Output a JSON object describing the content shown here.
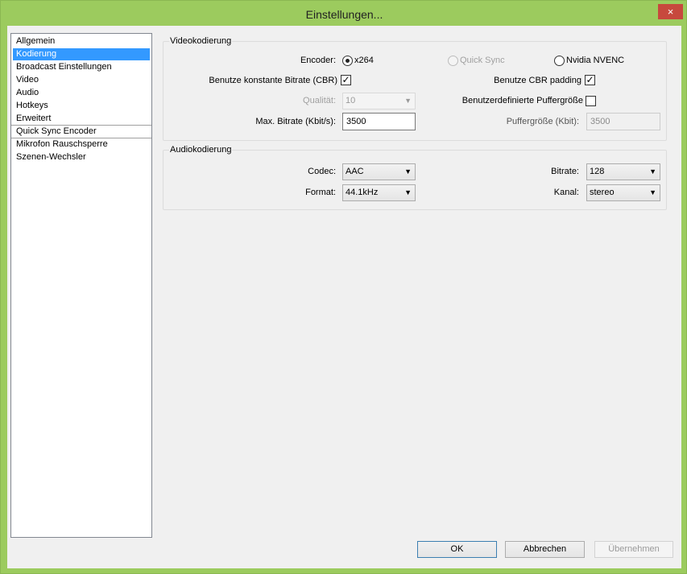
{
  "window": {
    "title": "Einstellungen...",
    "close_glyph": "×"
  },
  "nav": {
    "items": [
      {
        "label": "Allgemein"
      },
      {
        "label": "Kodierung"
      },
      {
        "label": "Broadcast Einstellungen"
      },
      {
        "label": "Video"
      },
      {
        "label": "Audio"
      },
      {
        "label": "Hotkeys"
      },
      {
        "label": "Erweitert"
      },
      {
        "label": "Quick Sync Encoder"
      },
      {
        "label": "Mikrofon Rauschsperre"
      },
      {
        "label": "Szenen-Wechsler"
      }
    ],
    "selected": "Kodierung"
  },
  "video": {
    "group_label": "Videokodierung",
    "encoder_label": "Encoder:",
    "encoder_options": [
      {
        "label": "x264",
        "checked": true,
        "enabled": true
      },
      {
        "label": "Quick Sync",
        "checked": false,
        "enabled": false
      },
      {
        "label": "Nvidia NVENC",
        "checked": false,
        "enabled": true
      }
    ],
    "cbr_label": "Benutze konstante Bitrate (CBR)",
    "cbr_checked": true,
    "cbr_padding_label": "Benutze CBR padding",
    "cbr_padding_checked": true,
    "quality_label": "Qualität:",
    "quality_value": "10",
    "custom_buffer_label": "Benutzerdefinierte Puffergröße",
    "custom_buffer_checked": false,
    "max_bitrate_label": "Max. Bitrate (Kbit/s):",
    "max_bitrate_value": "3500",
    "buffer_size_label": "Puffergröße (Kbit):",
    "buffer_size_value": "3500"
  },
  "audio": {
    "group_label": "Audiokodierung",
    "codec_label": "Codec:",
    "codec_value": "AAC",
    "bitrate_label": "Bitrate:",
    "bitrate_value": "128",
    "format_label": "Format:",
    "format_value": "44.1kHz",
    "channel_label": "Kanal:",
    "channel_value": "stereo"
  },
  "buttons": {
    "ok": "OK",
    "cancel": "Abbrechen",
    "apply": "Übernehmen"
  },
  "icons": {
    "close": "close-icon",
    "chevron": "chevron-down-icon",
    "check": "checkmark-icon"
  },
  "colors": {
    "titlebar": "#9ccb5e",
    "close_button": "#c7493d",
    "selection": "#3399ff"
  },
  "glyphs": {
    "chevron": "▼",
    "check": "✓"
  }
}
